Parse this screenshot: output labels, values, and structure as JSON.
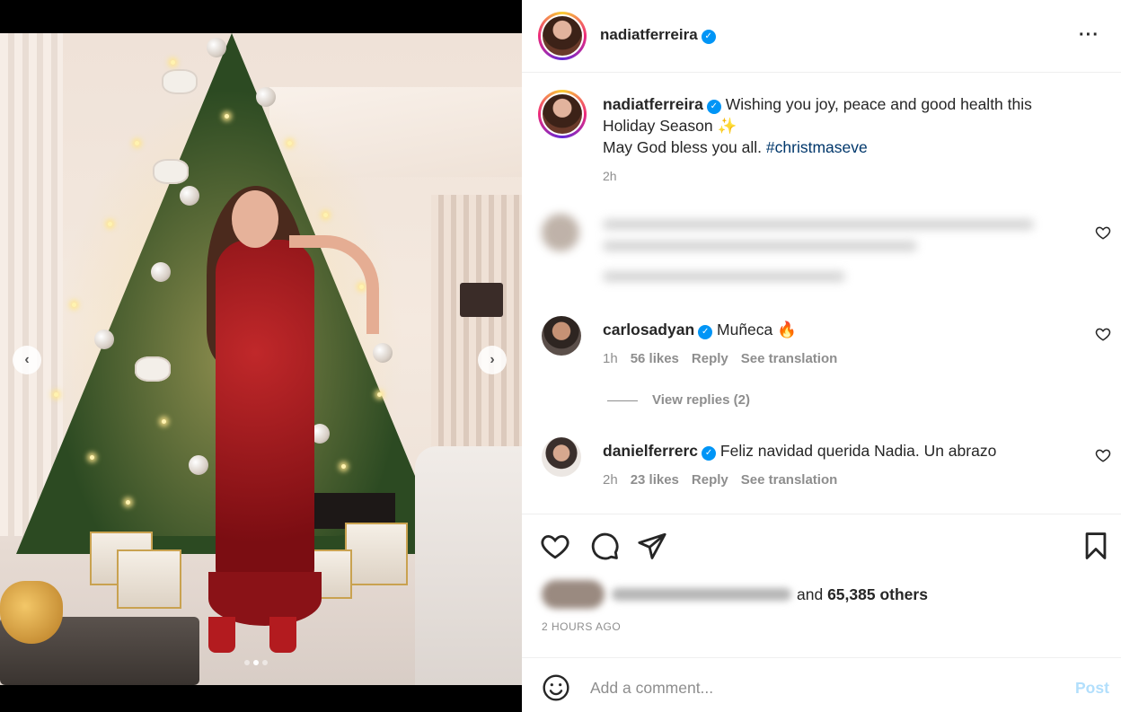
{
  "post": {
    "username": "nadiatferreira",
    "caption_line1": "Wishing you joy, peace and good health this",
    "caption_line2": "Holiday Season ✨",
    "caption_line3": "May God bless you all.",
    "hashtag": "#christmaseve",
    "time": "2h"
  },
  "comments": [
    {
      "username": "carlosadyan",
      "text": "Muñeca 🔥",
      "time": "1h",
      "likes": "56 likes",
      "reply": "Reply",
      "translate": "See translation"
    },
    {
      "username": "danielferrerc",
      "text": "Feliz navidad querida Nadia. Un abrazo",
      "time": "2h",
      "likes": "23 likes",
      "reply": "Reply",
      "translate": "See translation"
    }
  ],
  "view_replies": "View replies (2)",
  "likes": {
    "and_text": "and",
    "others": "65,385 others"
  },
  "posted_ago": "2 HOURS AGO",
  "comment_box": {
    "placeholder": "Add a comment...",
    "post_label": "Post"
  },
  "carousel": {
    "prev_icon": "chevron-left-icon",
    "next_icon": "chevron-right-icon",
    "slide_count": 3,
    "active_slide": 2
  },
  "colors": {
    "verified": "#0095f6",
    "hashtag": "#00376b",
    "post_disabled": "#b2dffc"
  }
}
